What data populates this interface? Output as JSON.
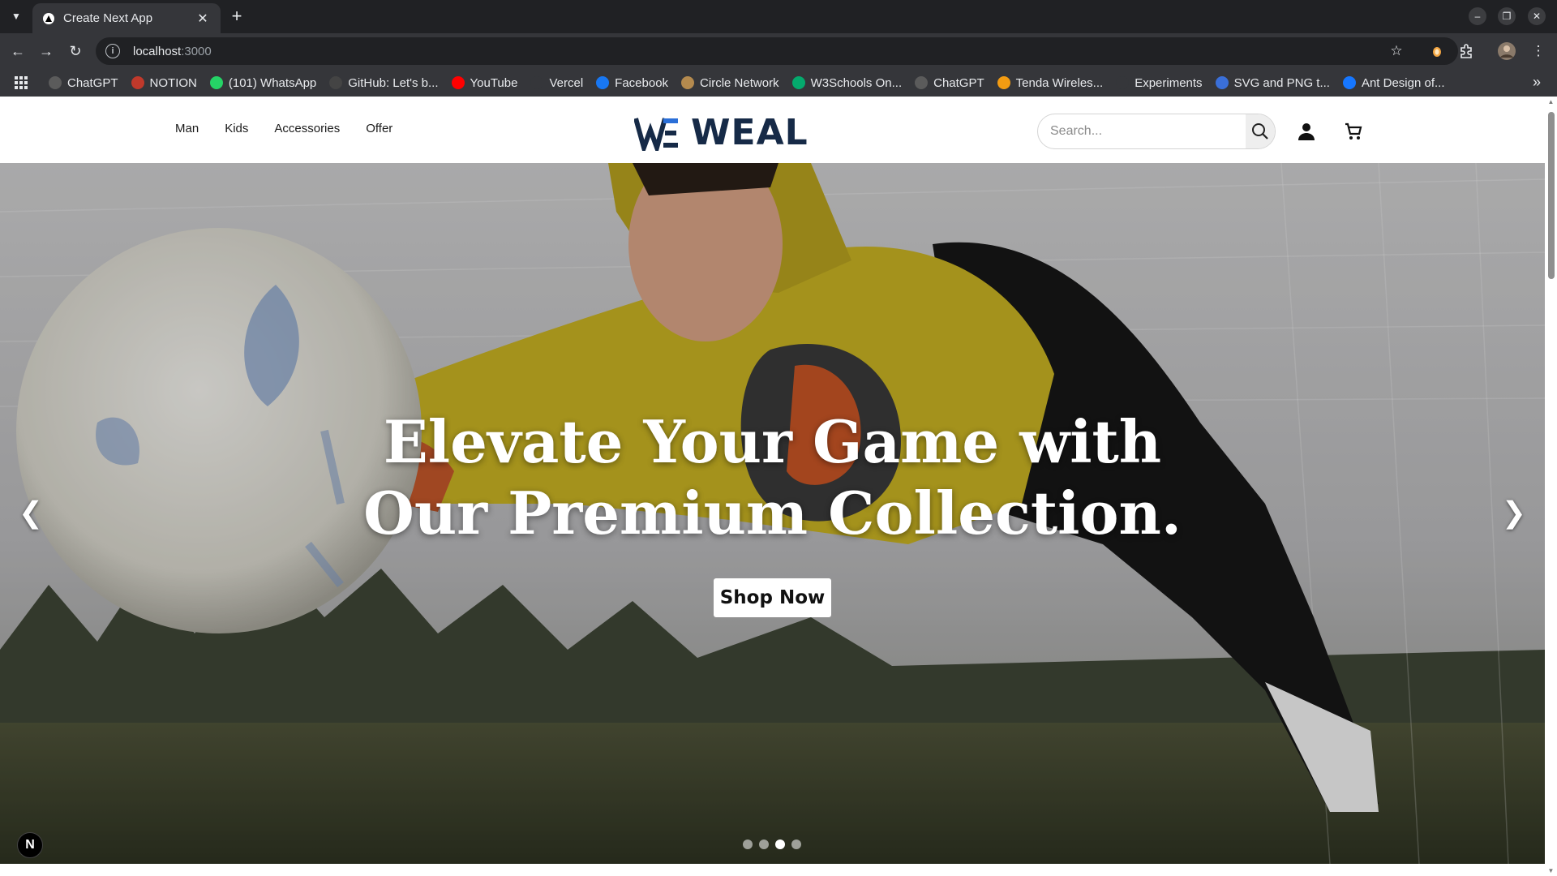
{
  "browser": {
    "tab": {
      "title": "Create Next App"
    },
    "url": {
      "host": "localhost",
      "port": ":3000"
    },
    "bookmarks": [
      {
        "label": "ChatGPT",
        "icon": "chatgpt-icon",
        "color": "#5b5b5b"
      },
      {
        "label": "NOTION",
        "icon": "code-icon",
        "color": "#c0392b"
      },
      {
        "label": "(101) WhatsApp",
        "icon": "whatsapp-icon",
        "color": "#25d366"
      },
      {
        "label": "GitHub: Let's b...",
        "icon": "github-icon",
        "color": "#444444"
      },
      {
        "label": "YouTube",
        "icon": "youtube-icon",
        "color": "#ff0000"
      },
      {
        "label": "Vercel",
        "icon": "folder-icon",
        "color": "#35363a"
      },
      {
        "label": "Facebook",
        "icon": "facebook-icon",
        "color": "#1877f2"
      },
      {
        "label": "Circle Network",
        "icon": "circle-network-icon",
        "color": "#b48a4e"
      },
      {
        "label": "W3Schools On...",
        "icon": "w3schools-icon",
        "color": "#04aa6d"
      },
      {
        "label": "ChatGPT",
        "icon": "chatgpt-icon",
        "color": "#5b5b5b"
      },
      {
        "label": "Tenda Wireles...",
        "icon": "tenda-icon",
        "color": "#f39c12"
      },
      {
        "label": "Experiments",
        "icon": "flask-icon",
        "color": "#35363a"
      },
      {
        "label": "SVG and PNG t...",
        "icon": "svg-icon",
        "color": "#3a6fd8"
      },
      {
        "label": "Ant Design of...",
        "icon": "ant-design-icon",
        "color": "#1677ff"
      }
    ]
  },
  "header": {
    "nav": [
      "Man",
      "Kids",
      "Accessories",
      "Offer"
    ],
    "logo_text": "WEAL",
    "search_placeholder": "Search..."
  },
  "hero": {
    "title_line1": "Elevate Your Game with",
    "title_line2": "Our Premium Collection.",
    "cta": "Shop Now",
    "prev_arrow": "❮",
    "next_arrow": "❯",
    "slide_count": 4,
    "active_slide": 3
  },
  "dev_badge": "N",
  "colors": {
    "brand": "#162a47",
    "chrome_dark": "#202124",
    "chrome_toolbar": "#35363a"
  }
}
